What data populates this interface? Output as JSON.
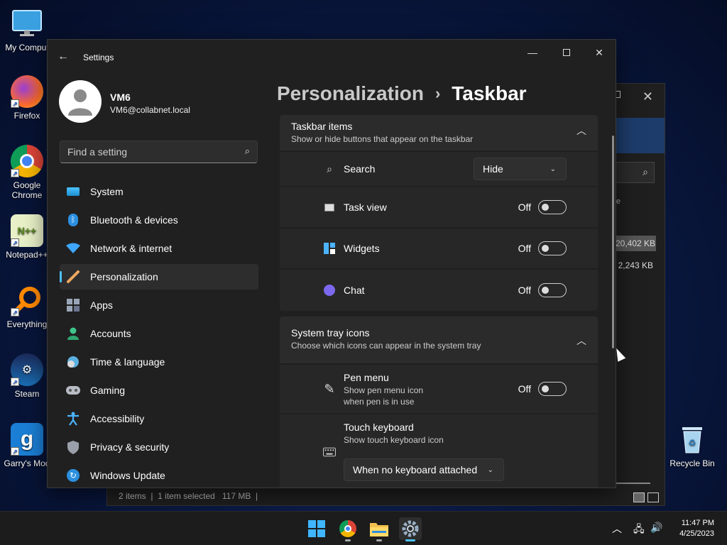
{
  "desktop": {
    "icons": [
      {
        "label": "My Comput",
        "icon": "computer-icon"
      },
      {
        "label": "Firefox",
        "icon": "firefox-icon"
      },
      {
        "label": "Google Chrome",
        "icon": "chrome-icon"
      },
      {
        "label": "Notepad++",
        "icon": "notepad-plus-plus-icon"
      },
      {
        "label": "Everything",
        "icon": "everything-search-icon"
      },
      {
        "label": "Steam",
        "icon": "steam-icon"
      },
      {
        "label": "Garry's Mod",
        "icon": "garrys-mod-icon"
      },
      {
        "label": "Recycle Bin",
        "icon": "recycle-bin-icon"
      }
    ]
  },
  "explorer": {
    "column_fragment": "e",
    "size_1": "20,402 KB",
    "size_2": "2,243 KB",
    "status": {
      "items": "2 items",
      "selected": "1 item selected",
      "size": "117 MB"
    }
  },
  "settings": {
    "window_title": "Settings",
    "profile": {
      "name": "VM6",
      "email": "VM6@collabnet.local"
    },
    "search": {
      "placeholder": "Find a setting"
    },
    "nav": [
      {
        "label": "System",
        "icon": "monitor-icon"
      },
      {
        "label": "Bluetooth & devices",
        "icon": "bluetooth-icon"
      },
      {
        "label": "Network & internet",
        "icon": "wifi-icon"
      },
      {
        "label": "Personalization",
        "icon": "brush-icon",
        "active": true
      },
      {
        "label": "Apps",
        "icon": "apps-icon"
      },
      {
        "label": "Accounts",
        "icon": "person-icon"
      },
      {
        "label": "Time & language",
        "icon": "clock-globe-icon"
      },
      {
        "label": "Gaming",
        "icon": "gamepad-icon"
      },
      {
        "label": "Accessibility",
        "icon": "accessibility-icon"
      },
      {
        "label": "Privacy & security",
        "icon": "shield-icon"
      },
      {
        "label": "Windows Update",
        "icon": "update-icon"
      }
    ],
    "breadcrumb": {
      "parent": "Personalization",
      "separator": "›",
      "current": "Taskbar"
    },
    "taskbar_items": {
      "title": "Taskbar items",
      "subtitle": "Show or hide buttons that appear on the taskbar",
      "search": {
        "label": "Search",
        "value": "Hide"
      },
      "task_view": {
        "label": "Task view",
        "state": "Off"
      },
      "widgets": {
        "label": "Widgets",
        "state": "Off"
      },
      "chat": {
        "label": "Chat",
        "state": "Off"
      }
    },
    "system_tray": {
      "title": "System tray icons",
      "subtitle": "Choose which icons can appear in the system tray",
      "pen_menu": {
        "label": "Pen menu",
        "desc_1": "Show pen menu icon",
        "desc_2": "when pen is in use",
        "state": "Off"
      },
      "touch_keyboard": {
        "label": "Touch keyboard",
        "desc": "Show touch keyboard icon",
        "value": "When no keyboard attached"
      }
    }
  },
  "taskbar": {
    "apps": [
      "start-icon",
      "chrome-icon",
      "file-explorer-icon",
      "settings-icon"
    ],
    "clock": {
      "time": "11:47 PM",
      "date": "4/25/2023"
    }
  },
  "colors": {
    "accent": "#4cc2ff",
    "window_bg": "#202020",
    "card_bg": "#272727"
  }
}
